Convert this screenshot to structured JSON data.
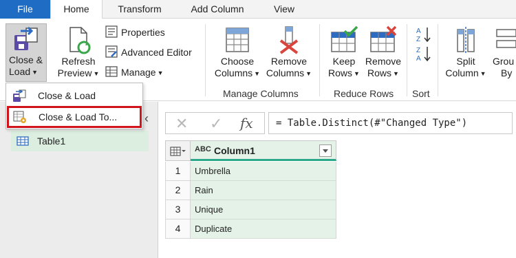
{
  "tabs": {
    "file": "File",
    "home": "Home",
    "transform": "Transform",
    "add_column": "Add Column",
    "view": "View"
  },
  "ribbon": {
    "close_load": {
      "line1": "Close &",
      "line2": "Load"
    },
    "refresh_preview": {
      "line1": "Refresh",
      "line2": "Preview"
    },
    "properties": "Properties",
    "advanced_editor": "Advanced Editor",
    "manage": "Manage",
    "choose_columns": {
      "line1": "Choose",
      "line2": "Columns"
    },
    "remove_columns": {
      "line1": "Remove",
      "line2": "Columns"
    },
    "manage_columns_group": "Manage Columns",
    "keep_rows": {
      "line1": "Keep",
      "line2": "Rows"
    },
    "remove_rows": {
      "line1": "Remove",
      "line2": "Rows"
    },
    "reduce_rows_group": "Reduce Rows",
    "sort_group": "Sort",
    "split_column": {
      "line1": "Split",
      "line2": "Column"
    },
    "group_by": {
      "line1": "Grou",
      "line2": "By"
    }
  },
  "dropdown": {
    "items": [
      "Close & Load",
      "Close & Load To..."
    ]
  },
  "queries": {
    "items": [
      "Table1"
    ]
  },
  "formula_bar": {
    "formula": "= Table.Distinct(#\"Changed Type\")",
    "fx": "fx"
  },
  "grid": {
    "column_type": "ABC",
    "column_name": "Column1",
    "rows": [
      {
        "num": "1",
        "value": "Umbrella"
      },
      {
        "num": "2",
        "value": "Rain"
      },
      {
        "num": "3",
        "value": "Unique"
      },
      {
        "num": "4",
        "value": "Duplicate"
      }
    ]
  },
  "colors": {
    "file_tab": "#1f6cc4",
    "highlight_border": "#d1141c",
    "column_underline": "#2aa889",
    "cell_fill": "#e4f2e8",
    "icon_red": "#d9443c",
    "icon_blue": "#2d6cc0",
    "icon_green": "#3aa64a"
  }
}
